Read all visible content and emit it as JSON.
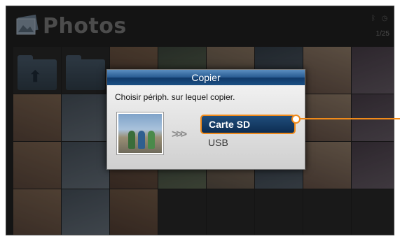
{
  "header": {
    "title": "Photos",
    "page_indicator": "1/25",
    "status_icons": [
      "bluetooth-icon",
      "clock-icon"
    ]
  },
  "grid": {
    "columns": 8,
    "rows": 4,
    "cells": [
      {
        "type": "folder",
        "icon": "folder-up-icon"
      },
      {
        "type": "folder",
        "icon": "folder-icon"
      },
      {
        "type": "photo"
      },
      {
        "type": "photo"
      },
      {
        "type": "photo"
      },
      {
        "type": "photo"
      },
      {
        "type": "photo"
      },
      {
        "type": "photo"
      },
      {
        "type": "photo"
      },
      {
        "type": "photo"
      },
      {
        "type": "photo"
      },
      {
        "type": "photo"
      },
      {
        "type": "photo"
      },
      {
        "type": "photo"
      },
      {
        "type": "photo"
      },
      {
        "type": "photo"
      },
      {
        "type": "photo"
      },
      {
        "type": "photo"
      },
      {
        "type": "photo"
      },
      {
        "type": "photo"
      },
      {
        "type": "photo"
      },
      {
        "type": "photo"
      },
      {
        "type": "photo"
      },
      {
        "type": "photo"
      },
      {
        "type": "photo"
      },
      {
        "type": "photo"
      },
      {
        "type": "photo"
      },
      {
        "type": "empty"
      },
      {
        "type": "empty"
      },
      {
        "type": "empty"
      },
      {
        "type": "empty"
      },
      {
        "type": "empty"
      }
    ]
  },
  "dialog": {
    "title": "Copier",
    "prompt": "Choisir périph. sur lequel copier.",
    "arrows": ">>>",
    "options": [
      {
        "label": "Carte SD",
        "selected": true
      },
      {
        "label": "USB",
        "selected": false
      }
    ]
  },
  "colors": {
    "highlight": "#f08a1a",
    "title_bar": "#1b4f84",
    "background": "#1c1c1c"
  }
}
